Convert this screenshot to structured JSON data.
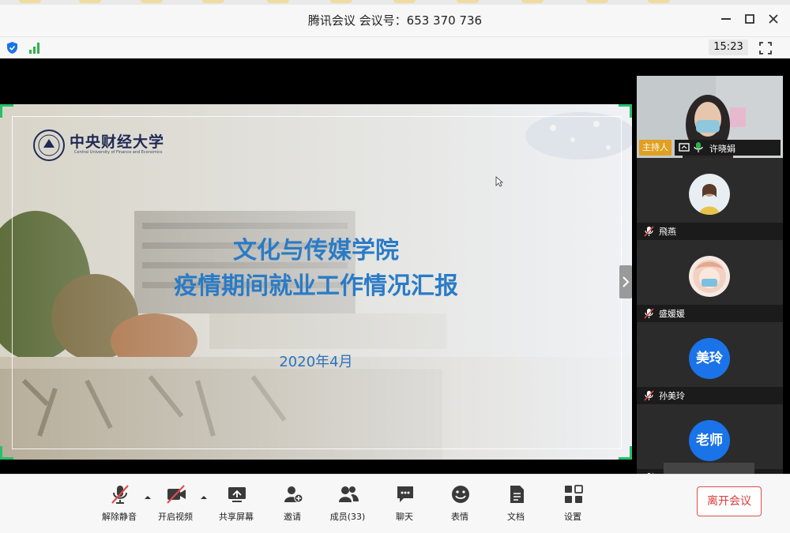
{
  "window": {
    "title": "腾讯会议 会议号：653 370 736",
    "time": "15:23"
  },
  "slide": {
    "university_name": "中央财经大学",
    "university_english": "Central University of Finance and Economics",
    "title_line1": "文化与传媒学院",
    "title_line2": "疫情期间就业工作情况汇报",
    "date": "2020年4月",
    "title_color": "#2a7bc6"
  },
  "participants": {
    "host_tag": "主持人",
    "host_name": "许晓娟",
    "items": [
      {
        "name": "飛燕",
        "avatar_text": ""
      },
      {
        "name": "盛媛媛",
        "avatar_text": ""
      },
      {
        "name": "孙美玲",
        "avatar_text": "美玲"
      },
      {
        "name": "",
        "avatar_text": "老师"
      }
    ]
  },
  "toolbar": {
    "mute": "解除静音",
    "video": "开启视频",
    "share": "共享屏幕",
    "invite": "邀请",
    "members": "成员(33)",
    "chat": "聊天",
    "reactions": "表情",
    "docs": "文档",
    "settings": "设置",
    "leave": "离开会议"
  },
  "colors": {
    "accent": "#1a73e8",
    "leave": "#e24b4b",
    "host_tag": "#e0a020",
    "share_corners": "#25c06a"
  }
}
